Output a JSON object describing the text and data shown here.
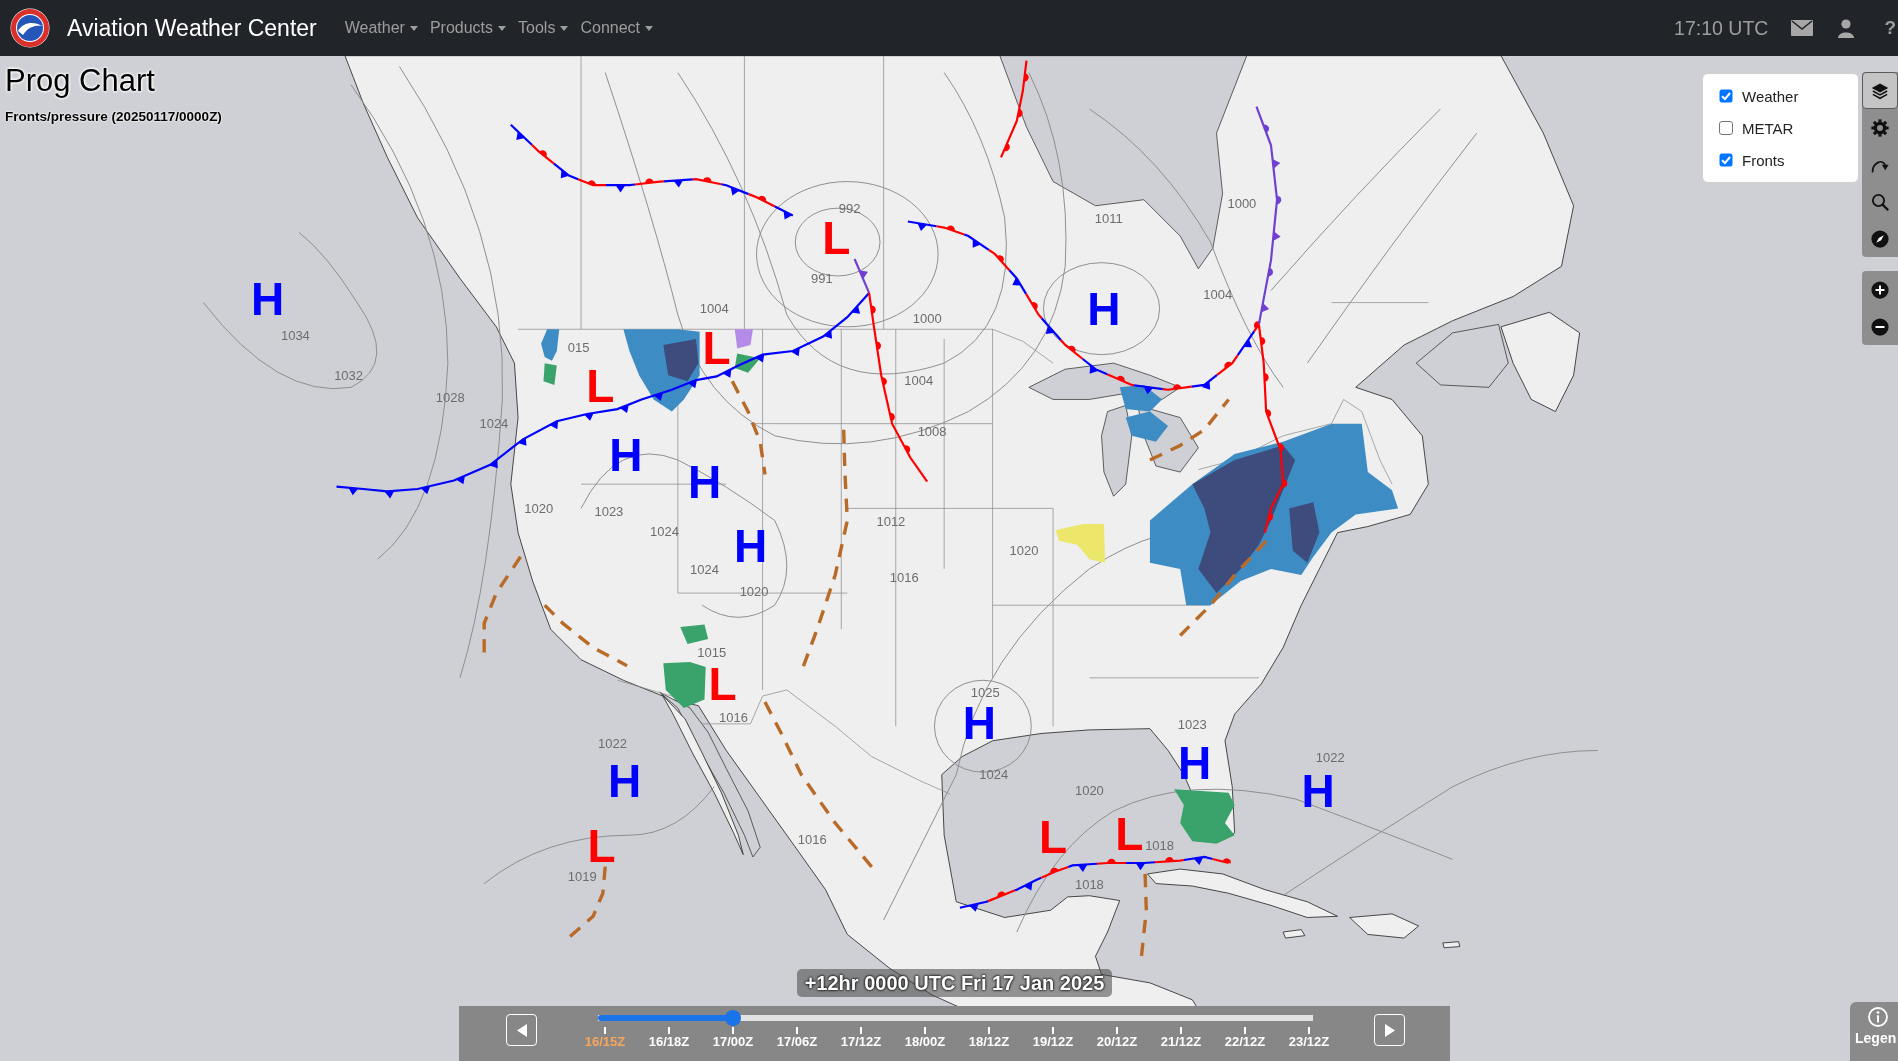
{
  "header": {
    "title": "Aviation Weather Center",
    "menus": [
      {
        "label": "Weather"
      },
      {
        "label": "Products"
      },
      {
        "label": "Tools"
      },
      {
        "label": "Connect"
      }
    ],
    "clock": "17:10 UTC",
    "help": "?"
  },
  "chart": {
    "title": "Prog Chart",
    "subtitle": "Fronts/pressure (20250117/0000Z)"
  },
  "layers": [
    {
      "kind": "weather",
      "label": "Weather",
      "checked": true
    },
    {
      "kind": "metar",
      "label": "METAR",
      "checked": false
    },
    {
      "kind": "fronts",
      "label": "Fronts",
      "checked": true
    }
  ],
  "tool_groups": [
    {
      "tools": [
        {
          "kind": "layers",
          "selected": true
        },
        {
          "kind": "settings",
          "selected": false
        },
        {
          "kind": "rotate",
          "selected": false
        },
        {
          "kind": "search",
          "selected": false
        },
        {
          "kind": "compass",
          "selected": false
        }
      ]
    },
    {
      "tools": [
        {
          "kind": "zoomin",
          "selected": false
        },
        {
          "kind": "zoomout",
          "selected": false
        }
      ]
    }
  ],
  "pressure_centers": [
    {
      "kind": "low",
      "symbol": "L"
    },
    {
      "kind": "high",
      "symbol": "H"
    },
    {
      "kind": "high",
      "symbol": "H"
    },
    {
      "kind": "low",
      "symbol": "L"
    },
    {
      "kind": "low",
      "symbol": "L"
    },
    {
      "kind": "high",
      "symbol": "H"
    },
    {
      "kind": "high",
      "symbol": "H"
    },
    {
      "kind": "high",
      "symbol": "H"
    },
    {
      "kind": "low",
      "symbol": "L"
    },
    {
      "kind": "high",
      "symbol": "H"
    },
    {
      "kind": "high",
      "symbol": "H"
    },
    {
      "kind": "high",
      "symbol": "H"
    },
    {
      "kind": "high",
      "symbol": "H"
    },
    {
      "kind": "low",
      "symbol": "L"
    },
    {
      "kind": "low",
      "symbol": "L"
    },
    {
      "kind": "low",
      "symbol": "L"
    }
  ],
  "isobar_labels": [
    "992",
    "1000",
    "1011",
    "991",
    "1004",
    "1004",
    "1000",
    "1034",
    "015",
    "1032",
    "1004",
    "1028",
    "1024",
    "1008",
    "1020",
    "1023",
    "1024",
    "1012",
    "1020",
    "1024",
    "1016",
    "1020",
    "1015",
    "1025",
    "1016",
    "1023",
    "1022",
    "1022",
    "1024",
    "1020",
    "1016",
    "1018",
    "1019",
    "1018"
  ],
  "timeline": {
    "caption": "+12hr 0000 UTC Fri 17 Jan 2025",
    "level": 0.189,
    "ticks": [
      {
        "label": "16/15Z",
        "current": true
      },
      {
        "label": "16/18Z",
        "current": false
      },
      {
        "label": "17/00Z",
        "current": false
      },
      {
        "label": "17/06Z",
        "current": false
      },
      {
        "label": "17/12Z",
        "current": false
      },
      {
        "label": "18/00Z",
        "current": false
      },
      {
        "label": "18/12Z",
        "current": false
      },
      {
        "label": "19/12Z",
        "current": false
      },
      {
        "label": "20/12Z",
        "current": false
      },
      {
        "label": "21/12Z",
        "current": false
      },
      {
        "label": "22/12Z",
        "current": false
      },
      {
        "label": "23/12Z",
        "current": false
      }
    ]
  },
  "legend_button": {
    "label": "Legen"
  }
}
